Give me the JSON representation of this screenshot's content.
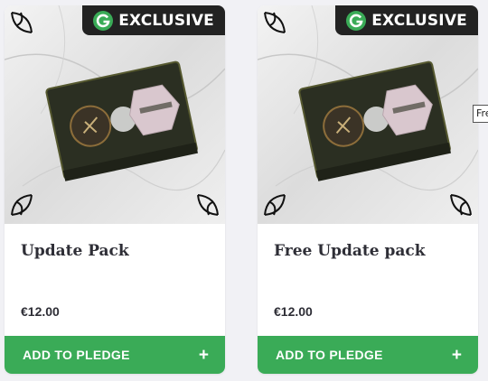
{
  "cards": [
    {
      "badge": "EXCLUSIVE",
      "title": "Update Pack",
      "price": "€12.00",
      "button_label": "ADD TO PLEDGE",
      "button_icon": "+"
    },
    {
      "badge": "EXCLUSIVE",
      "title": "Free Update pack",
      "price": "€12.00",
      "button_label": "ADD TO PLEDGE",
      "button_icon": "+"
    }
  ],
  "tooltip": {
    "text": "Free Update pack"
  },
  "colors": {
    "accent": "#3aab57",
    "badge_bg": "#222222",
    "page_bg": "#f1f1f5",
    "text": "#2e2e36"
  }
}
